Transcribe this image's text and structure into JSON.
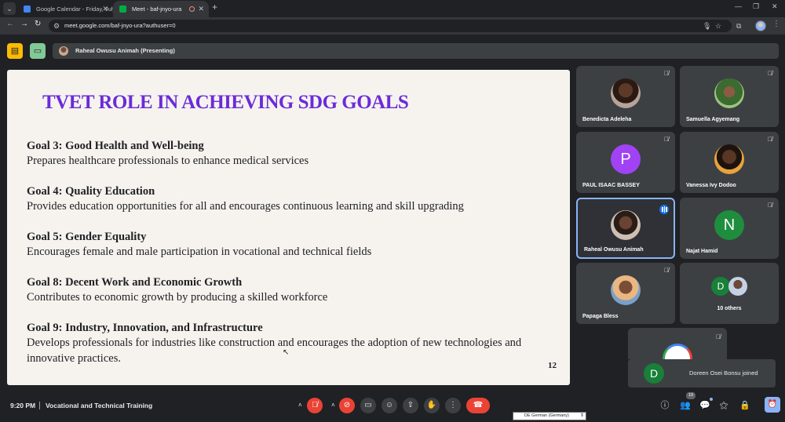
{
  "browser": {
    "tabs": [
      {
        "title": "Google Calendar - Friday, July",
        "fav_color": "#4285f4"
      },
      {
        "title": "Meet - baf-jnyo-ura",
        "fav_color": "#00ac47"
      }
    ],
    "url": "meet.google.com/baf-jnyo-ura?authuser=0"
  },
  "meet": {
    "presenter_label": "Raheal Owusu Animah (Presenting)"
  },
  "slide": {
    "title": "TVET ROLE IN ACHIEVING SDG GOALS",
    "goals": [
      {
        "heading": "Goal 3: Good Health and Well-being",
        "text": "Prepares healthcare professionals to enhance medical services"
      },
      {
        "heading": "Goal 4: Quality Education",
        "text": "Provides education opportunities for all and encourages continuous learning and skill upgrading"
      },
      {
        "heading": "Goal 5: Gender Equality",
        "text": "Encourages female and male participation in vocational and technical fields"
      },
      {
        "heading": "Goal 8: Decent Work and Economic Growth",
        "text": "Contributes to economic growth by producing a skilled workforce"
      },
      {
        "heading": "Goal 9: Industry, Innovation, and Infrastructure",
        "text": "Develops professionals for industries like construction and encourages the adoption of new technologies and innovative practices."
      }
    ],
    "page_number": "12"
  },
  "participants": [
    {
      "name": "Benedicta Adeleha",
      "muted": true
    },
    {
      "name": "Samuella Agyemang",
      "muted": true
    },
    {
      "name": "PAUL ISAAC BASSEY",
      "initial": "P",
      "color": "#a142f4",
      "muted": true
    },
    {
      "name": "Vanessa Ivy Dodoo",
      "muted": true
    },
    {
      "name": "Raheal Owusu Animah",
      "speaking": true
    },
    {
      "name": "Najat Hamid",
      "initial": "N",
      "color": "#1e8e3e",
      "muted": true
    },
    {
      "name": "Papaga Bless",
      "muted": true
    }
  ],
  "others": {
    "initial": "D",
    "label": "10 others"
  },
  "toast": {
    "initial": "D",
    "text": "Doreen Osei Bonsu joined"
  },
  "bottom": {
    "time": "9:20 PM",
    "meeting_name": "Vocational and Technical Training",
    "participant_count": "19",
    "language_select": "DE German (Germany)"
  }
}
